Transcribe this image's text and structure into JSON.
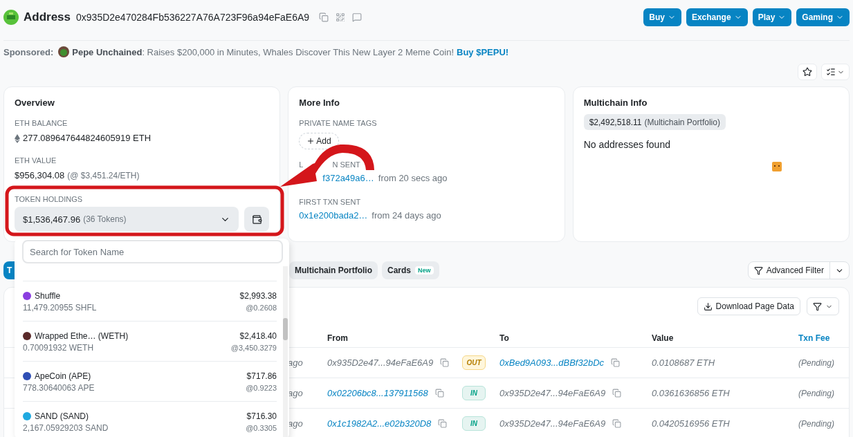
{
  "header": {
    "title": "Address",
    "address": "0x935D2e470284Fb536227A76A723F96a94eFaE6A9",
    "menus": [
      {
        "label": "Buy"
      },
      {
        "label": "Exchange"
      },
      {
        "label": "Play"
      },
      {
        "label": "Gaming"
      }
    ]
  },
  "sponsored": {
    "label": "Sponsored:",
    "text": "**Pepe Unchained**: Raises $200,000 in Minutes, Whales Discover This New Layer 2 Meme Coin!",
    "link": "Buy $PEPU!"
  },
  "overview": {
    "title": "Overview",
    "eth_balance": {
      "label": "ETH BALANCE",
      "value": "277.089647644824605919 ETH"
    },
    "eth_value": {
      "label": "ETH VALUE",
      "value": "$956,304.08",
      "rate": "(@ $3,451.24/ETH)"
    },
    "token_holdings": {
      "label": "TOKEN HOLDINGS",
      "value": "$1,536,467.96",
      "count": "(36 Tokens)",
      "expanded": true
    }
  },
  "token_dropdown": {
    "placeholder": "Search for Token Name",
    "tokens": [
      {
        "name": "Shuffle",
        "amount": "11,479.20955 SHFL",
        "value": "$2,993.38",
        "price": "@0.2608",
        "color": "#8a3ee0"
      },
      {
        "name": "Wrapped Ethe… (WETH)",
        "amount": "0.70091932 WETH",
        "value": "$2,418.40",
        "price": "@3,450.3279",
        "color": "#5a2a2a"
      },
      {
        "name": "ApeCoin (APE)",
        "amount": "778.30640063 APE",
        "value": "$717.86",
        "price": "@0.9223",
        "color": "#2f4fb5"
      },
      {
        "name": "SAND (SAND)",
        "amount": "2,167.05929203 SAND",
        "value": "$716.30",
        "price": "@0.3305",
        "color": "#1fa9e0"
      }
    ]
  },
  "more_info": {
    "title": "More Info",
    "tags_label": "PRIVATE NAME TAGS",
    "add": "Add",
    "last_txn": {
      "label_parts": [
        "L",
        "N SENT"
      ],
      "hash": "f372a49a6…",
      "age": "from 20 secs ago"
    },
    "first_txn": {
      "label": "FIRST TXN SENT",
      "hash": "0x1e200bada2…",
      "age": "from 24 days ago"
    }
  },
  "multichain": {
    "title": "Multichain Info",
    "portfolio_value": "$2,492,518.11",
    "portfolio_label": "(Multichain Portfolio)",
    "message": "No addresses found"
  },
  "tabs": [
    {
      "label": "T",
      "selected": true
    },
    {
      "label": "Multichain Portfolio",
      "selected": false
    },
    {
      "label": "Cards",
      "badge": "New",
      "selected": false
    }
  ],
  "advanced_filter": "Advanced Filter",
  "table": {
    "download": "Download Page Data",
    "columns": [
      {
        "label": "From",
        "link": false
      },
      {
        "label": "To",
        "link": false
      },
      {
        "label": "Value",
        "link": false
      },
      {
        "label": "Txn Fee",
        "link": true
      }
    ],
    "rows": [
      {
        "age": "ago",
        "from": "0x935D2e47...94eFaE6A9",
        "from_link": false,
        "direction": {
          "label": "OUT",
          "kind": "out"
        },
        "to": "0xBed9A093...dBBf32bDc",
        "to_link": true,
        "value": "0.0108687 ETH",
        "fee": "(Pending)"
      },
      {
        "age": "ago",
        "from": "0x02206bc8...137911568",
        "from_link": true,
        "direction": {
          "label": "IN",
          "kind": "in"
        },
        "to": "0x935D2e47...94eFaE6A9",
        "to_link": false,
        "value": "0.0361636856 ETH",
        "fee": "(Pending)"
      },
      {
        "age": "ago",
        "from": "0x1c1982A2...e02b320D8",
        "from_link": true,
        "direction": {
          "label": "IN",
          "kind": "in"
        },
        "to": "0x935D2e47...94eFaE6A9",
        "to_link": false,
        "value": "0.0420516956 ETH",
        "fee": "(Pending)"
      }
    ]
  }
}
